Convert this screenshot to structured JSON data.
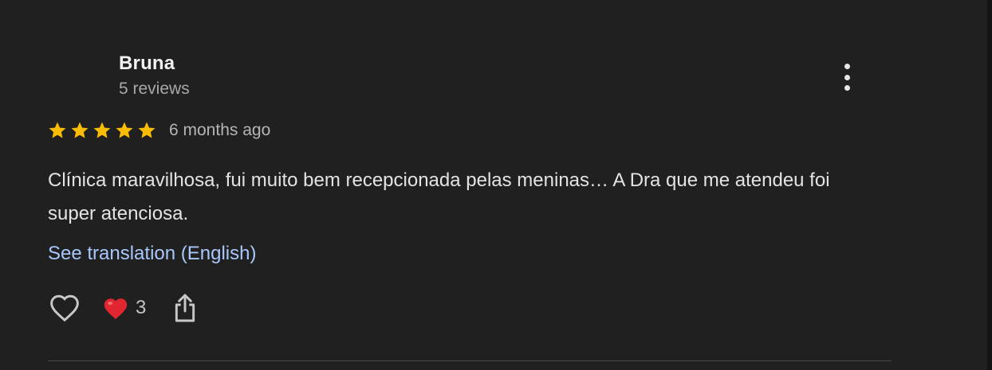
{
  "review": {
    "author_name": "Bruna",
    "author_meta": "5 reviews",
    "rating": 5,
    "rating_max": 5,
    "date": "6 months ago",
    "text": "Clínica maravilhosa, fui muito bem recepcionada pelas meninas… A Dra que me atendeu foi super atenciosa.",
    "translate_label": "See translation (English)",
    "reaction_count": "3"
  },
  "icons": {
    "more": "more-vert-icon",
    "star": "star-icon",
    "like": "heart-outline-icon",
    "reaction": "red-heart-icon",
    "share": "share-icon"
  },
  "colors": {
    "background": "#202020",
    "star": "#fbbc04",
    "link": "#a8c7fa",
    "reaction_heart": "#e0262f"
  }
}
